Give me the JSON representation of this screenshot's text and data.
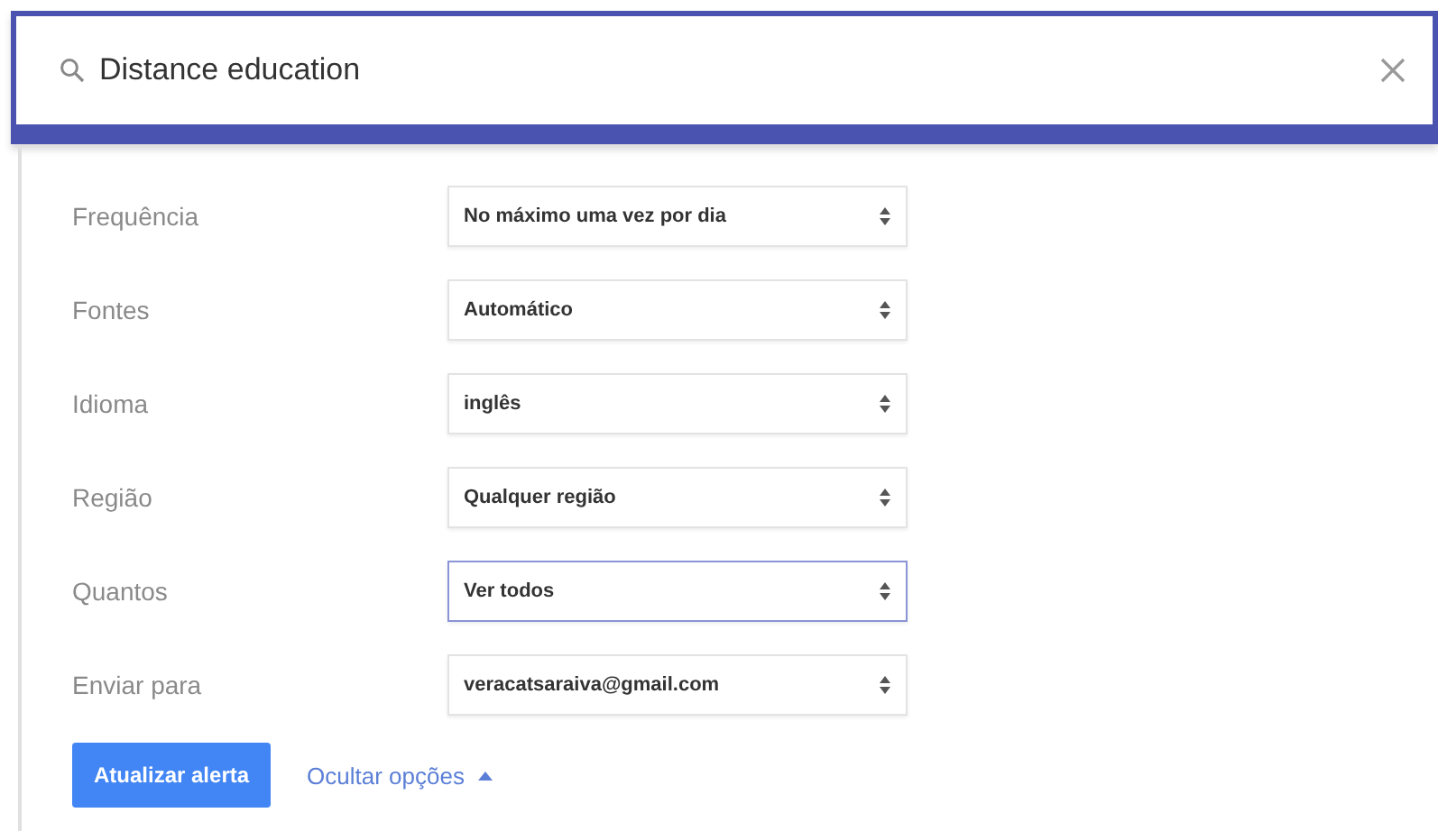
{
  "search": {
    "value": "Distance education"
  },
  "options": [
    {
      "label": "Frequência",
      "value": "No máximo uma vez por dia",
      "focused": false
    },
    {
      "label": "Fontes",
      "value": "Automático",
      "focused": false
    },
    {
      "label": "Idioma",
      "value": "inglês",
      "focused": false
    },
    {
      "label": "Região",
      "value": "Qualquer região",
      "focused": false
    },
    {
      "label": "Quantos",
      "value": "Ver todos",
      "focused": true
    },
    {
      "label": "Enviar para",
      "value": "veracatsaraiva@gmail.com",
      "focused": false
    }
  ],
  "update_button": "Atualizar alerta",
  "hide_options_link": "Ocultar opções"
}
